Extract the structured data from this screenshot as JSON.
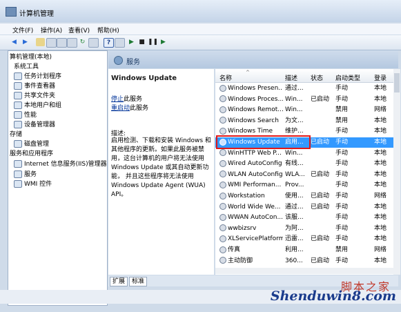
{
  "window": {
    "title": "计算机管理"
  },
  "menu": [
    "文件(F)",
    "操作(A)",
    "查看(V)",
    "帮助(H)"
  ],
  "tree": [
    {
      "label": "算机管理(本地)",
      "indent": 0
    },
    {
      "label": "系统工具",
      "indent": 1
    },
    {
      "label": "任务计划程序",
      "indent": 2
    },
    {
      "label": "事件查看器",
      "indent": 2
    },
    {
      "label": "共享文件夹",
      "indent": 2
    },
    {
      "label": "本地用户和组",
      "indent": 2
    },
    {
      "label": "性能",
      "indent": 2
    },
    {
      "label": "设备管理器",
      "indent": 2
    },
    {
      "label": "存储",
      "indent": 0
    },
    {
      "label": "磁盘管理",
      "indent": 2
    },
    {
      "label": "服务和应用程序",
      "indent": 0
    },
    {
      "label": "Internet 信息服务(IIS)管理器",
      "indent": 2
    },
    {
      "label": "服务",
      "indent": 2
    },
    {
      "label": "WMI 控件",
      "indent": 2
    }
  ],
  "services_header": {
    "title": "服务"
  },
  "detail": {
    "name": "Windows Update",
    "stop_link": "停止",
    "stop_suffix": "此服务",
    "restart_link": "重启动",
    "restart_suffix": "此服务",
    "desc_label": "描述:",
    "desc_lines": [
      "启用检测、下载和安装 Windows 和",
      "其他程序的更新。如果此服务被禁",
      "用，这台计算机的用户将无法使用",
      "Windows Update 或其自动更新功",
      "能， 并且这些程序将无法使用",
      "Windows Update Agent (WUA)",
      "API。"
    ]
  },
  "columns": [
    "名称",
    "描述",
    "状态",
    "启动类型",
    "登录"
  ],
  "rows": [
    {
      "name": "Windows Presen...",
      "desc": "通过...",
      "status": "",
      "start": "手动",
      "logon": "本地"
    },
    {
      "name": "Windows Proces...",
      "desc": "Win...",
      "status": "已启动",
      "start": "手动",
      "logon": "本地"
    },
    {
      "name": "Windows Remot...",
      "desc": "Win...",
      "status": "",
      "start": "禁用",
      "logon": "网络"
    },
    {
      "name": "Windows Search",
      "desc": "为文...",
      "status": "",
      "start": "禁用",
      "logon": "本地"
    },
    {
      "name": "Windows Time",
      "desc": "维护...",
      "status": "",
      "start": "手动",
      "logon": "本地"
    },
    {
      "name": "Windows Update",
      "desc": "启用...",
      "status": "已启动",
      "start": "手动",
      "logon": "本地",
      "selected": true
    },
    {
      "name": "WinHTTP Web P...",
      "desc": "Win...",
      "status": "",
      "start": "手动",
      "logon": "本地"
    },
    {
      "name": "Wired AutoConfig",
      "desc": "有线...",
      "status": "",
      "start": "手动",
      "logon": "本地"
    },
    {
      "name": "WLAN AutoConfig",
      "desc": "WLA...",
      "status": "已启动",
      "start": "手动",
      "logon": "本地"
    },
    {
      "name": "WMI Performan...",
      "desc": "Prov...",
      "status": "",
      "start": "手动",
      "logon": "本地"
    },
    {
      "name": "Workstation",
      "desc": "使用...",
      "status": "已启动",
      "start": "手动",
      "logon": "网络"
    },
    {
      "name": "World Wide We...",
      "desc": "通过...",
      "status": "已启动",
      "start": "手动",
      "logon": "本地"
    },
    {
      "name": "WWAN AutoCon...",
      "desc": "该服...",
      "status": "",
      "start": "手动",
      "logon": "本地"
    },
    {
      "name": "wwbizsrv",
      "desc": "为阿...",
      "status": "",
      "start": "手动",
      "logon": "本地"
    },
    {
      "name": "XLServicePlatform",
      "desc": "迅雷...",
      "status": "已启动",
      "start": "手动",
      "logon": "本地"
    },
    {
      "name": "传真",
      "desc": "利用...",
      "status": "",
      "start": "禁用",
      "logon": "网络"
    },
    {
      "name": "主动防御",
      "desc": "360...",
      "status": "已启动",
      "start": "手动",
      "logon": "本地"
    }
  ],
  "tabs": [
    "扩展",
    "标准"
  ],
  "watermark": {
    "line1": "脚本之家",
    "line2": "Shenduwin8.com"
  },
  "colors": {
    "selection": "#3399ff",
    "highlight_box": "#e01818",
    "link": "#003399"
  }
}
